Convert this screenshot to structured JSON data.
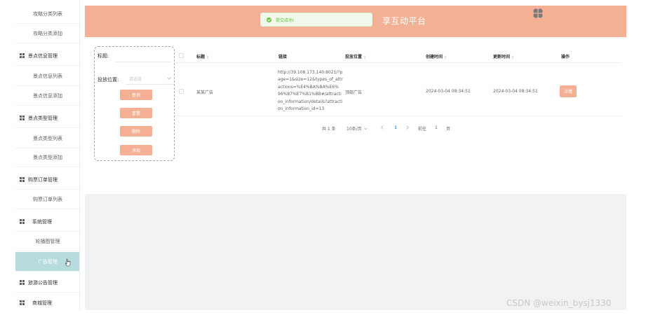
{
  "sidebar": {
    "items": [
      {
        "label": "攻略分类列表",
        "type": "sub"
      },
      {
        "label": "攻略分类添加",
        "type": "sub"
      },
      {
        "label": "景点信息管理",
        "type": "group",
        "icon": "grid-icon"
      },
      {
        "label": "景点信息列表",
        "type": "sub"
      },
      {
        "label": "景点信息添加",
        "type": "sub"
      },
      {
        "label": "景点类型管理",
        "type": "group",
        "icon": "grid-icon"
      },
      {
        "label": "景点类型列表",
        "type": "sub"
      },
      {
        "label": "景点类型添加",
        "type": "sub"
      },
      {
        "label": "购票订单管理",
        "type": "group",
        "icon": "grid-icon"
      },
      {
        "label": "购票订单列表",
        "type": "sub"
      },
      {
        "label": "系统管理",
        "type": "group",
        "icon": "grid-icon"
      },
      {
        "label": "轮播图管理",
        "type": "sub"
      },
      {
        "label": "广告管理",
        "type": "sub",
        "active": true
      },
      {
        "label": "旅游公告管理",
        "type": "group",
        "icon": "grid-icon"
      },
      {
        "label": "商城管理",
        "type": "group",
        "icon": "grid-icon"
      }
    ]
  },
  "header": {
    "title": "享互动平台",
    "logo_icon": "clover-logo-icon",
    "color": "#f4b095"
  },
  "toast": {
    "message": "提交成功!",
    "icon": "success-check-icon",
    "color": "#67c23a"
  },
  "search": {
    "title_label": "标题:",
    "title_value": "",
    "position_label": "投放位置:",
    "position_placeholder": "请选择",
    "buttons": {
      "search": "查询",
      "reset": "重置",
      "delete": "删除",
      "add": "添加"
    }
  },
  "table": {
    "columns": [
      "标题",
      "链接",
      "投放位置",
      "创建时间",
      "更新时间",
      "操作"
    ],
    "rows": [
      {
        "title": "某某广告",
        "link": "http://39.108.173.140:8021/?p\nage=1&size=12&types_of_attr\nactions=%E4%BA%BA%E6%\n96%87%E7%B1%BB#/attracti\non_information/details?attracti\non_information_id=13",
        "position": "顶部广告",
        "created": "2024-03-04 08:34:51",
        "updated": "2024-03-04 08:34:51",
        "action": "详情"
      }
    ]
  },
  "pagination": {
    "total": "共 1 条",
    "page_size": "10条/页",
    "current_page": "1",
    "goto_label": "前往",
    "goto_value": "1",
    "page_suffix": "页"
  },
  "watermark": "CSDN @weixin_bysj1330"
}
